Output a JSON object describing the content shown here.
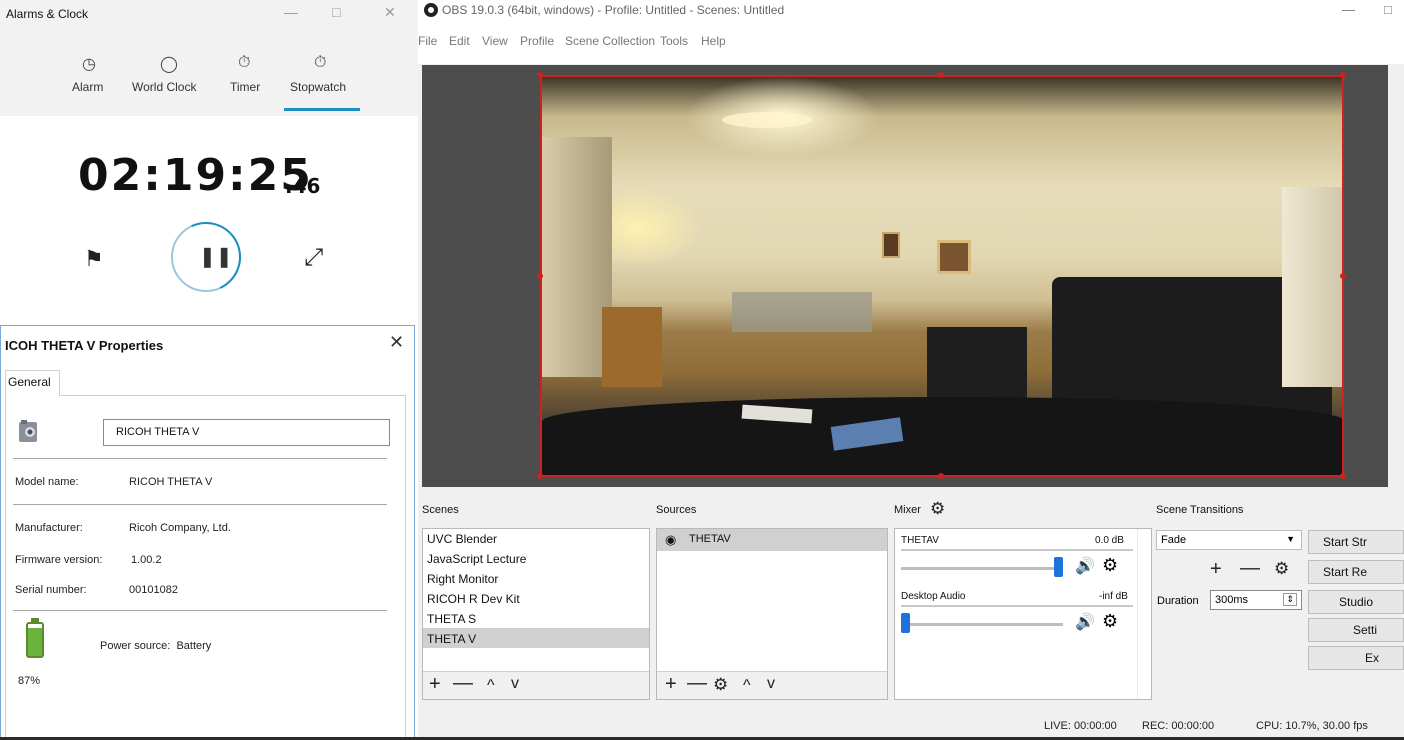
{
  "obs": {
    "title": "OBS 19.0.3 (64bit, windows) - Profile: Untitled - Scenes: Untitled",
    "window_controls": {
      "minimize": "—",
      "maximize": "□"
    },
    "menu": [
      "File",
      "Edit",
      "View",
      "Profile",
      "Scene Collection",
      "Tools",
      "Help"
    ],
    "docks": {
      "scenes": {
        "title": "Scenes",
        "items": [
          "UVC Blender",
          "JavaScript Lecture",
          "Right Monitor",
          "RICOH R Dev Kit",
          "THETA S",
          "THETA V"
        ],
        "selected_index": 5,
        "toolbar": {
          "add": "+",
          "remove": "—",
          "up": "^",
          "down": "v"
        }
      },
      "sources": {
        "title": "Sources",
        "items": [
          {
            "name": "THETAV",
            "icon": "eye-icon"
          }
        ],
        "toolbar": {
          "add": "+",
          "remove": "—",
          "settings": "⚙",
          "up": "^",
          "down": "v"
        }
      },
      "mixer": {
        "title": "Mixer",
        "channels": [
          {
            "name": "THETAV",
            "db": "0.0 dB",
            "volume": 1.0
          },
          {
            "name": "Desktop Audio",
            "db": "-inf dB",
            "volume": 0.0
          }
        ]
      },
      "transitions": {
        "title": "Scene Transitions",
        "selected": "Fade",
        "duration_label": "Duration",
        "duration_value": "300ms"
      }
    },
    "controls": [
      "Start Str",
      "Start Re",
      "Studio",
      "Setti",
      "Ex"
    ],
    "status": {
      "live": "LIVE: 00:00:00",
      "rec": "REC: 00:00:00",
      "cpu": "CPU: 10.7%, 30.00 fps"
    },
    "accent_color": "#d02020"
  },
  "alarms": {
    "title": "Alarms & Clock",
    "window_controls": {
      "minimize": "—",
      "maximize": "□",
      "close": "✕"
    },
    "tabs": [
      {
        "label": "Alarm",
        "icon": "alarm-icon"
      },
      {
        "label": "World Clock",
        "icon": "world-clock-icon"
      },
      {
        "label": "Timer",
        "icon": "timer-icon"
      },
      {
        "label": "Stopwatch",
        "icon": "stopwatch-icon"
      }
    ],
    "active_tab": "Stopwatch",
    "stopwatch": {
      "time": "02:19:25",
      "hundredths": ".46"
    },
    "accent_color": "#1a8fc0"
  },
  "properties": {
    "title": "ICOH THETA V Properties",
    "tab": "General",
    "device_name": "RICOH THETA V",
    "fields": [
      {
        "label": "Model name:",
        "value": "RICOH THETA V"
      },
      {
        "label": "Manufacturer:",
        "value": "Ricoh Company, Ltd."
      },
      {
        "label": "Firmware version:",
        "value": "1.00.2"
      },
      {
        "label": "Serial number:",
        "value": "00101082"
      }
    ],
    "power": {
      "label": "Power source:",
      "value": "Battery"
    },
    "battery_percent": "87%",
    "battery_level": 0.87
  }
}
